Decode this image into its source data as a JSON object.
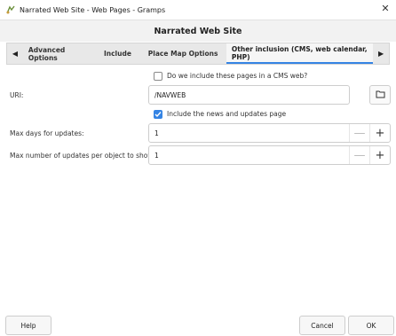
{
  "window": {
    "title": "Narrated Web Site - Web Pages - Gramps"
  },
  "dialog": {
    "header": "Narrated Web Site"
  },
  "tabs": [
    {
      "label": "Advanced Options"
    },
    {
      "label": "Include"
    },
    {
      "label": "Place Map Options"
    },
    {
      "label": "Other inclusion (CMS, web calendar, PHP)"
    }
  ],
  "form": {
    "cms_checkbox_label": "Do we include these pages in a CMS web?",
    "uri_label": "URI:",
    "uri_value": "/NAVWEB",
    "news_checkbox_label": "Include the news and updates page",
    "max_days_label": "Max days for updates:",
    "max_days_value": "1",
    "max_updates_label": "Max number of updates per object to show:",
    "max_updates_value": "1"
  },
  "buttons": {
    "help": "Help",
    "cancel": "Cancel",
    "ok": "OK"
  },
  "colors": {
    "accent": "#3584e4"
  }
}
